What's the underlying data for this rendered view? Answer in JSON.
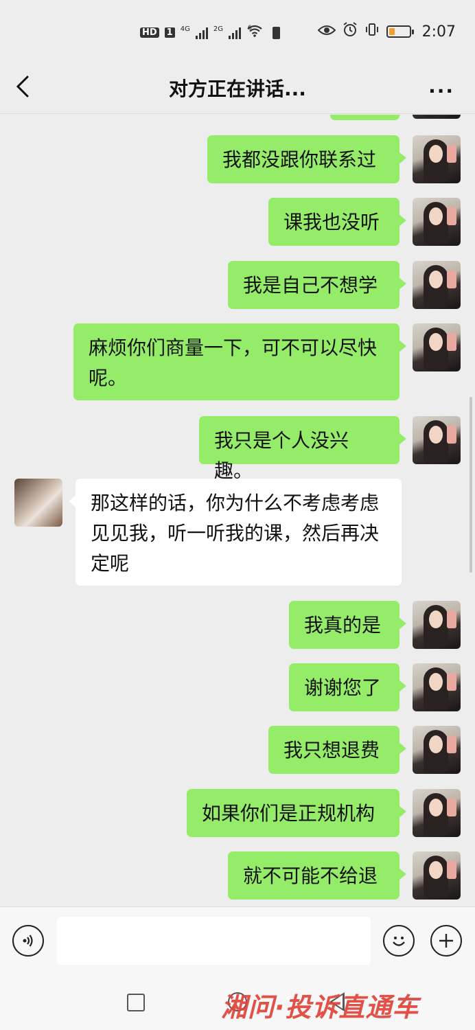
{
  "status_bar": {
    "hd": "HD",
    "sim1": "1",
    "net1": "4G",
    "net2": "2G",
    "wifi": "6",
    "time": "2:07"
  },
  "header": {
    "title": "对方正在讲话...",
    "more": "···"
  },
  "messages": [
    {
      "from": "me",
      "text": "我都没跟你联系过"
    },
    {
      "from": "me",
      "text": "课我也没听"
    },
    {
      "from": "me",
      "text": "我是自己不想学"
    },
    {
      "from": "me",
      "text": "麻烦你们商量一下，可不可以尽快呢。"
    },
    {
      "from": "me",
      "text": "我只是个人没兴趣。"
    },
    {
      "from": "them",
      "text": "那这样的话，你为什么不考虑考虑见见我，听一听我的课，然后再决定呢"
    },
    {
      "from": "me",
      "text": "我真的是"
    },
    {
      "from": "me",
      "text": "谢谢您了"
    },
    {
      "from": "me",
      "text": "我只想退费"
    },
    {
      "from": "me",
      "text": "如果你们是正规机构"
    },
    {
      "from": "me",
      "text": "就不可能不给退"
    }
  ],
  "input_bar": {
    "voice_icon": "voice-icon",
    "emoji_icon": "emoji-icon",
    "plus_icon": "plus-icon"
  },
  "watermark": "湘问·投诉直通车",
  "colors": {
    "me_bubble": "#95ec69",
    "them_bubble": "#ffffff",
    "background": "#ededed",
    "watermark": "#e0443a"
  }
}
